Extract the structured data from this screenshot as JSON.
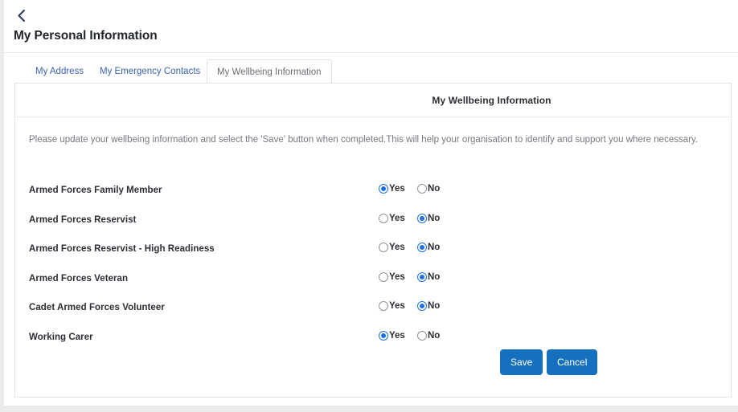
{
  "header": {
    "back_icon": "chevron-left-icon",
    "title": "My Personal Information"
  },
  "tabs": [
    {
      "label": "My Address",
      "active": false
    },
    {
      "label": "My Emergency Contacts",
      "active": false
    },
    {
      "label": "My Wellbeing Information",
      "active": true
    }
  ],
  "card": {
    "title": "My Wellbeing Information",
    "intro": "Please update your wellbeing information and select the 'Save' button when completed.This will help your organisation to identify and support you where necessary."
  },
  "options": {
    "yes_label": "Yes",
    "no_label": "No"
  },
  "questions": [
    {
      "label": "Armed Forces Family Member",
      "value": "Yes"
    },
    {
      "label": "Armed Forces Reservist",
      "value": "No"
    },
    {
      "label": "Armed Forces Reservist - High Readiness",
      "value": "No"
    },
    {
      "label": "Armed Forces Veteran",
      "value": "No"
    },
    {
      "label": "Cadet Armed Forces Volunteer",
      "value": "No"
    },
    {
      "label": "Working Carer",
      "value": "Yes"
    }
  ],
  "actions": {
    "save_label": "Save",
    "cancel_label": "Cancel"
  },
  "colors": {
    "accent_blue": "#1570c0",
    "link_blue": "#3a62b0",
    "radio_blue": "#1f6fe0",
    "text_dark": "#2b2e33",
    "text_muted": "#75797f"
  }
}
